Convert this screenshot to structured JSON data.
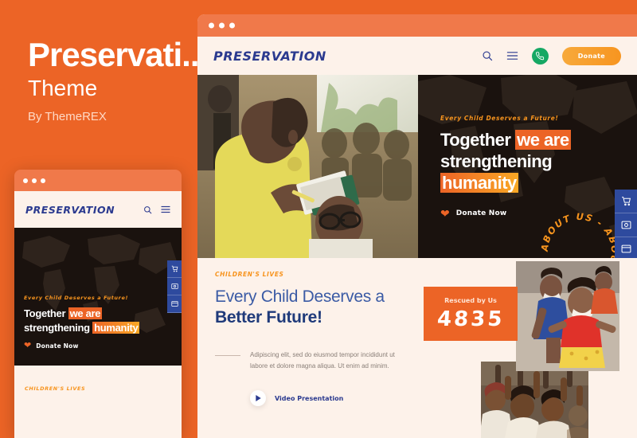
{
  "promo": {
    "title": "Preservati..",
    "subtitle": "Theme",
    "author": "By ThemeREX"
  },
  "colors": {
    "brand_orange": "#EC6426",
    "titlebar_orange": "#F0794A",
    "cream": "#FDF2EA",
    "dark": "#1A120E",
    "navy": "#2B3A8F",
    "heading_blue": "#1F3A7A",
    "accent_yellow": "#F7941E",
    "green": "#16A864",
    "side_btn_blue": "#2E4A9E"
  },
  "site": {
    "logo": "PRESERVATION",
    "header": {
      "search_icon": "search-icon",
      "menu_icon": "hamburger-menu-icon",
      "phone_icon": "whatsapp-phone-icon",
      "donate_label": "Donate"
    },
    "hero": {
      "tagline": "Every Child Deserves a Future!",
      "headline_part1": "Together ",
      "headline_highlight1": "we are",
      "headline_part2": "strengthening",
      "headline_highlight2": "humanity",
      "cta_label": "Donate Now",
      "heart_icon": "heart-icon",
      "circular_text": "ABOUT US  -  ABOUT US  -  ",
      "photo_alt": "student-reading-book-in-classroom"
    },
    "side_buttons": [
      {
        "name": "cart-icon",
        "label": "Cart"
      },
      {
        "name": "gallery-icon",
        "label": "Gallery"
      },
      {
        "name": "window-icon",
        "label": "Layouts"
      }
    ],
    "lower": {
      "eyebrow": "CHILDREN'S LIVES",
      "heading_line1": "Every Child Deserves a",
      "heading_line2": "Better Future!",
      "paragraph": "Adipiscing elit, sed do eiusmod tempor incididunt ut labore et dolore magna aliqua. Ut enim ad minim.",
      "video_label": "Video Presentation",
      "play_icon": "play-icon",
      "stat_label": "Rescued by Us",
      "stat_value": "4835",
      "photo_a_alt": "children-running-and-smiling",
      "photo_b_alt": "children-raising-hands-in-classroom"
    }
  },
  "window_dots": [
    "dot",
    "dot",
    "dot"
  ]
}
